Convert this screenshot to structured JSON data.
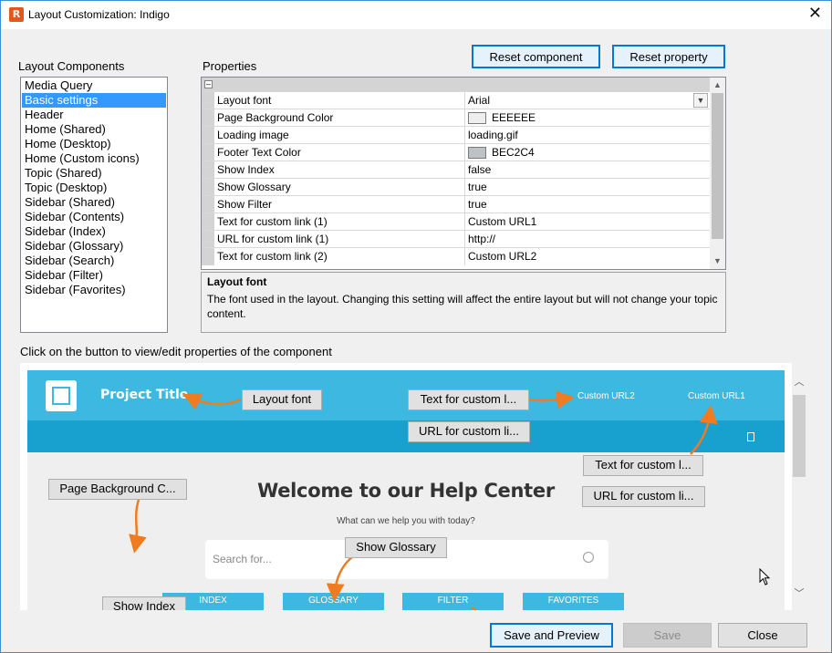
{
  "window": {
    "title": "Layout Customization: Indigo",
    "app_icon_letter": "R"
  },
  "labels": {
    "layout_components": "Layout Components",
    "properties": "Properties",
    "click_hint": "Click on the button to view/edit properties of the component"
  },
  "buttons": {
    "reset_component": "Reset component",
    "reset_property": "Reset property",
    "save_and_preview": "Save and Preview",
    "save": "Save",
    "close": "Close"
  },
  "components": [
    "Media Query",
    "Basic settings",
    "Header",
    "Home (Shared)",
    "Home (Desktop)",
    "Home (Custom icons)",
    "Topic (Shared)",
    "Topic (Desktop)",
    "Sidebar (Shared)",
    "Sidebar (Contents)",
    "Sidebar (Index)",
    "Sidebar (Glossary)",
    "Sidebar (Search)",
    "Sidebar (Filter)",
    "Sidebar (Favorites)"
  ],
  "selected_component": "Basic settings",
  "properties": [
    {
      "name": "Layout font",
      "value": "Arial"
    },
    {
      "name": "Page Background Color",
      "value": "EEEEEE",
      "swatch": "#eeeeee"
    },
    {
      "name": "Loading image",
      "value": "loading.gif"
    },
    {
      "name": "Footer Text Color",
      "value": "BEC2C4",
      "swatch": "#bec2c4"
    },
    {
      "name": "Show Index",
      "value": "false"
    },
    {
      "name": "Show Glossary",
      "value": "true"
    },
    {
      "name": "Show Filter",
      "value": "true"
    },
    {
      "name": "Text for custom link (1)",
      "value": "Custom URL1"
    },
    {
      "name": "URL for custom link (1)",
      "value": "http://"
    },
    {
      "name": "Text for custom link (2)",
      "value": "Custom URL2"
    }
  ],
  "description": {
    "title": "Layout font",
    "text": "The font used in the layout. Changing this setting will affect the entire layout but will not change your topic content."
  },
  "preview": {
    "project_title": "Project Title",
    "custom_url2": "Custom URL2",
    "custom_url1": "Custom URL1",
    "heading": "Welcome to our Help Center",
    "subheading": "What can we help you with today?",
    "search_placeholder": "Search for...",
    "tabs": [
      "INDEX",
      "GLOSSARY",
      "FILTER",
      "FAVORITES"
    ],
    "overlay_buttons": {
      "layout_font": "Layout font",
      "text_custom_1": "Text for custom l...",
      "url_custom_1": "URL for custom li...",
      "text_custom_2": "Text for custom l...",
      "url_custom_2": "URL for custom li...",
      "page_background": "Page Background C...",
      "show_glossary": "Show Glossary",
      "show_index": "Show Index"
    }
  },
  "colors": {
    "preview_header": "#3db8e0",
    "preview_header_dark": "#18a0cf",
    "arrow": "#f07c1f",
    "selection": "#3399ff"
  },
  "icons": [
    "close-icon",
    "image-logo-icon",
    "bookmark-icon",
    "search-icon",
    "mouse-cursor-icon",
    "chevron-down-icon"
  ]
}
